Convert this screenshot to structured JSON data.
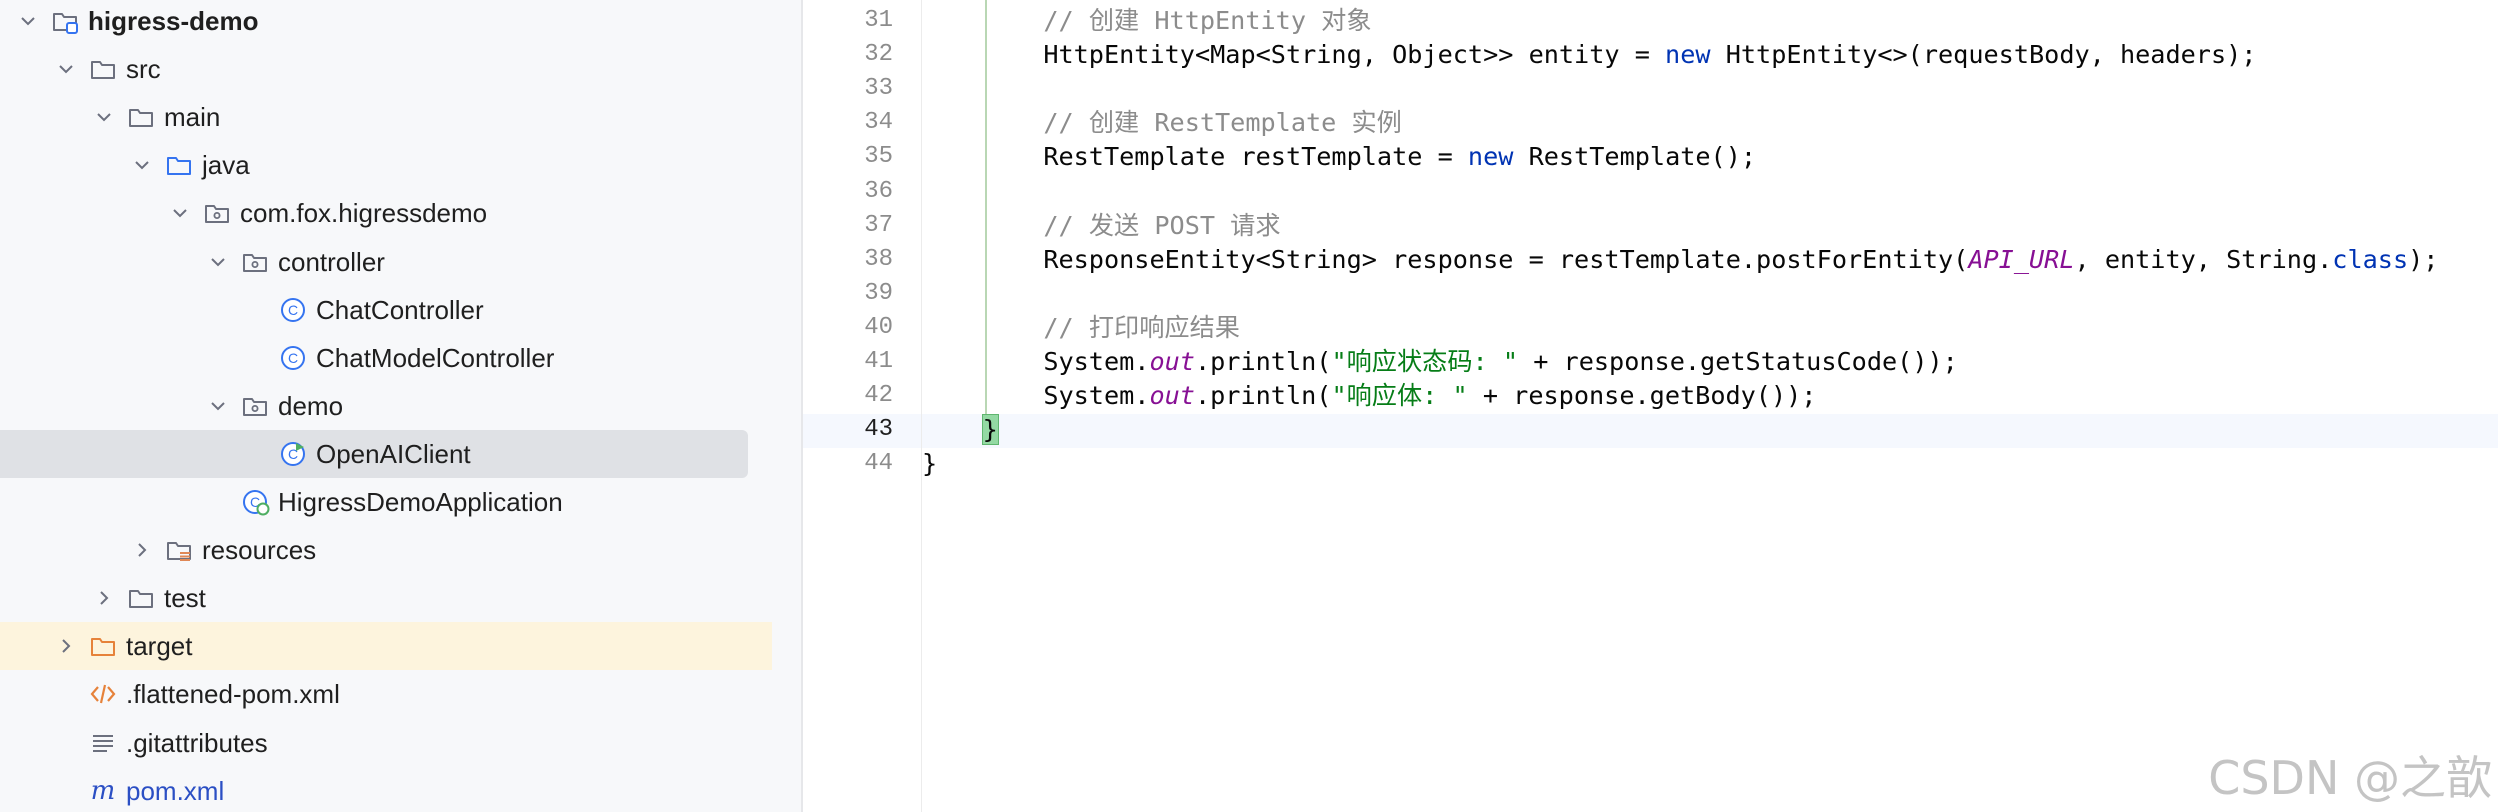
{
  "project_tree": {
    "items": [
      {
        "label": "higress-demo",
        "depth": 0,
        "expanded": true,
        "icon": "module-folder-icon",
        "bold": true
      },
      {
        "label": "src",
        "depth": 1,
        "expanded": true,
        "icon": "folder-icon"
      },
      {
        "label": "main",
        "depth": 2,
        "expanded": true,
        "icon": "folder-icon"
      },
      {
        "label": "java",
        "depth": 3,
        "expanded": true,
        "icon": "source-folder-icon"
      },
      {
        "label": "com.fox.higressdemo",
        "depth": 4,
        "expanded": true,
        "icon": "package-icon"
      },
      {
        "label": "controller",
        "depth": 5,
        "expanded": true,
        "icon": "package-icon"
      },
      {
        "label": "ChatController",
        "depth": 6,
        "icon": "java-class-icon"
      },
      {
        "label": "ChatModelController",
        "depth": 6,
        "icon": "java-class-icon"
      },
      {
        "label": "demo",
        "depth": 5,
        "expanded": true,
        "icon": "package-icon"
      },
      {
        "label": "OpenAIClient",
        "depth": 6,
        "icon": "java-runnable-class-icon",
        "selected": true
      },
      {
        "label": "HigressDemoApplication",
        "depth": 5,
        "icon": "spring-boot-class-icon"
      },
      {
        "label": "resources",
        "depth": 3,
        "expanded": false,
        "icon": "resources-folder-icon"
      },
      {
        "label": "test",
        "depth": 2,
        "expanded": false,
        "icon": "folder-icon"
      },
      {
        "label": "target",
        "depth": 1,
        "expanded": false,
        "icon": "excluded-folder-icon",
        "excluded": true
      },
      {
        "label": ".flattened-pom.xml",
        "depth": 1,
        "icon": "xml-file-icon"
      },
      {
        "label": ".gitattributes",
        "depth": 1,
        "icon": "text-file-icon"
      },
      {
        "label": "pom.xml",
        "depth": 1,
        "icon": "maven-file-icon",
        "blue": true
      }
    ]
  },
  "editor": {
    "current_line": 43,
    "lines": [
      {
        "n": 31,
        "text": "        // 创建 HttpEntity 对象"
      },
      {
        "n": 32,
        "text": "        HttpEntity<Map<String, Object>> entity = new HttpEntity<>(requestBody, headers);"
      },
      {
        "n": 33,
        "text": ""
      },
      {
        "n": 34,
        "text": "        // 创建 RestTemplate 实例"
      },
      {
        "n": 35,
        "text": "        RestTemplate restTemplate = new RestTemplate();"
      },
      {
        "n": 36,
        "text": ""
      },
      {
        "n": 37,
        "text": "        // 发送 POST 请求"
      },
      {
        "n": 38,
        "text": "        ResponseEntity<String> response = restTemplate.postForEntity(API_URL, entity, String.class);"
      },
      {
        "n": 39,
        "text": ""
      },
      {
        "n": 40,
        "text": "        // 打印响应结果"
      },
      {
        "n": 41,
        "text": "        System.out.println(\"响应状态码: \" + response.getStatusCode());"
      },
      {
        "n": 42,
        "text": "        System.out.println(\"响应体: \" + response.getBody());"
      },
      {
        "n": 43,
        "text": "    }"
      },
      {
        "n": 44,
        "text": "}"
      }
    ]
  },
  "colors": {
    "keyword": "#0033b3",
    "string": "#067d17",
    "comment": "#8c8c8c",
    "static_field": "#871094",
    "selection": "#dfe1e5",
    "excluded_bg": "#fdf4dd"
  },
  "watermark": "CSDN @之歆"
}
